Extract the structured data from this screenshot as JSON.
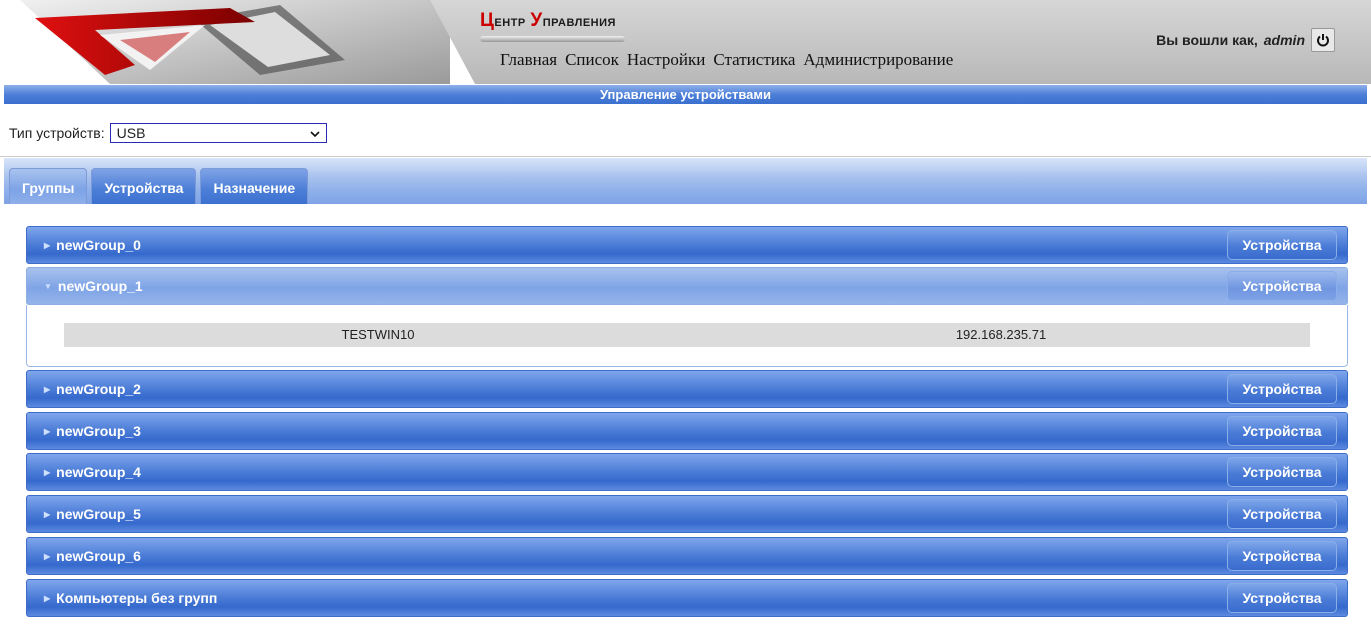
{
  "header": {
    "title_part1_cap": "Ц",
    "title_part1_rest": "ентр ",
    "title_part2_cap": "У",
    "title_part2_rest": "правления",
    "nav": [
      "Главная",
      "Список",
      "Настройки",
      "Статистика",
      "Администрирование"
    ],
    "login_prefix": "Вы вошли как,",
    "login_user": "admin"
  },
  "page": {
    "heading": "Управление устройствами",
    "device_type_label": "Тип устройств:",
    "device_type_value": "USB"
  },
  "tabs": [
    "Группы",
    "Устройства",
    "Назначение"
  ],
  "active_tab": "Группы",
  "groups": [
    {
      "name": "newGroup_0",
      "button": "Устройства"
    },
    {
      "name": "newGroup_1",
      "button": "Устройства",
      "expanded": true
    },
    {
      "name": "newGroup_2",
      "button": "Устройства"
    },
    {
      "name": "newGroup_3",
      "button": "Устройства"
    },
    {
      "name": "newGroup_4",
      "button": "Устройства"
    },
    {
      "name": "newGroup_5",
      "button": "Устройства"
    },
    {
      "name": "newGroup_6",
      "button": "Устройства"
    },
    {
      "name": "Компьютеры без групп",
      "button": "Устройства"
    }
  ],
  "expanded_rows": [
    {
      "computer": "TESTWIN10",
      "ip": "192.168.235.71"
    }
  ],
  "colors": {
    "accent": "#4a7bd6",
    "title_red": "#cc0000"
  }
}
